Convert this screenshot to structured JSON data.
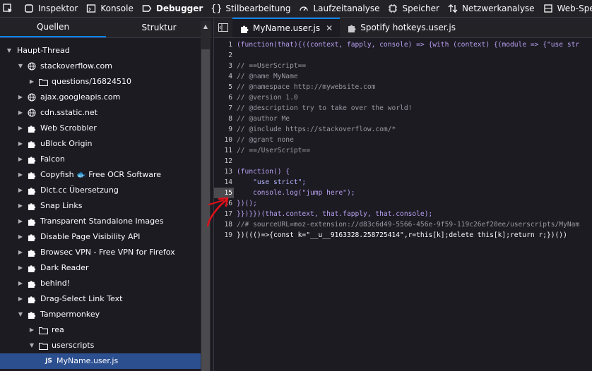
{
  "toolbar": {
    "tabs": [
      {
        "label": "Inspektor",
        "icon": "inspector-icon"
      },
      {
        "label": "Konsole",
        "icon": "console-icon"
      },
      {
        "label": "Debugger",
        "icon": "debugger-icon",
        "active": true
      },
      {
        "label": "Stilbearbeitung",
        "icon": "style-editor-icon"
      },
      {
        "label": "Laufzeitanalyse",
        "icon": "performance-icon"
      },
      {
        "label": "Speicher",
        "icon": "memory-icon"
      },
      {
        "label": "Netzwerkanalyse",
        "icon": "network-icon"
      },
      {
        "label": "Web-Speicher",
        "icon": "storage-icon"
      }
    ]
  },
  "left_panel": {
    "tabs": [
      {
        "label": "Quellen",
        "active": true
      },
      {
        "label": "Struktur"
      }
    ]
  },
  "tree": [
    {
      "label": "Haupt-Thread",
      "indent": 0,
      "expanded": true,
      "icon": "thread"
    },
    {
      "label": "stackoverflow.com",
      "indent": 1,
      "expanded": true,
      "icon": "globe"
    },
    {
      "label": "questions/16824510",
      "indent": 2,
      "expanded": false,
      "icon": "folder"
    },
    {
      "label": "ajax.googleapis.com",
      "indent": 1,
      "expanded": false,
      "icon": "globe"
    },
    {
      "label": "cdn.sstatic.net",
      "indent": 1,
      "expanded": false,
      "icon": "globe"
    },
    {
      "label": "Web Scrobbler",
      "indent": 1,
      "expanded": false,
      "icon": "extension"
    },
    {
      "label": "uBlock Origin",
      "indent": 1,
      "expanded": false,
      "icon": "extension"
    },
    {
      "label": "Falcon",
      "indent": 1,
      "expanded": false,
      "icon": "extension"
    },
    {
      "label": "Copyfish 🐟 Free OCR Software",
      "indent": 1,
      "expanded": false,
      "icon": "extension"
    },
    {
      "label": "Dict.cc Übersetzung",
      "indent": 1,
      "expanded": false,
      "icon": "extension"
    },
    {
      "label": "Snap Links",
      "indent": 1,
      "expanded": false,
      "icon": "extension"
    },
    {
      "label": "Transparent Standalone Images",
      "indent": 1,
      "expanded": false,
      "icon": "extension"
    },
    {
      "label": "Disable Page Visibility API",
      "indent": 1,
      "expanded": false,
      "icon": "extension"
    },
    {
      "label": "Browsec VPN - Free VPN for Firefox",
      "indent": 1,
      "expanded": false,
      "icon": "extension"
    },
    {
      "label": "Dark Reader",
      "indent": 1,
      "expanded": false,
      "icon": "extension"
    },
    {
      "label": "behind!",
      "indent": 1,
      "expanded": false,
      "icon": "extension"
    },
    {
      "label": "Drag-Select Link Text",
      "indent": 1,
      "expanded": false,
      "icon": "extension"
    },
    {
      "label": "Tampermonkey",
      "indent": 1,
      "expanded": true,
      "icon": "extension"
    },
    {
      "label": "rea",
      "indent": 2,
      "expanded": false,
      "icon": "folder"
    },
    {
      "label": "userscripts",
      "indent": 2,
      "expanded": true,
      "icon": "folder"
    },
    {
      "label": "MyName.user.js",
      "indent": 3,
      "icon": "js",
      "selected": true
    }
  ],
  "editor": {
    "tabs": [
      {
        "label": "MyName.user.js",
        "active": true,
        "closable": true
      },
      {
        "label": "Spotify hotkeys.user.js",
        "active": false
      }
    ],
    "lines": [
      {
        "n": "1",
        "text": "(function(that){((context, fapply, console) => {with (context) {(module => {\"use str",
        "kind": "code"
      },
      {
        "n": "2",
        "text": "",
        "kind": "code"
      },
      {
        "n": "3",
        "text": "// ==UserScript==",
        "kind": "comment"
      },
      {
        "n": "4",
        "text": "// @name MyName",
        "kind": "comment"
      },
      {
        "n": "5",
        "text": "// @namespace http://mywebsite.com",
        "kind": "comment"
      },
      {
        "n": "6",
        "text": "// @version 1.0",
        "kind": "comment"
      },
      {
        "n": "7",
        "text": "// @description try to take over the world!",
        "kind": "comment"
      },
      {
        "n": "8",
        "text": "// @author Me",
        "kind": "comment"
      },
      {
        "n": "9",
        "text": "// @include https://stackoverflow.com/*",
        "kind": "comment"
      },
      {
        "n": "10",
        "text": "// @grant none",
        "kind": "comment"
      },
      {
        "n": "11",
        "text": "// ==/UserScript==",
        "kind": "comment"
      },
      {
        "n": "12",
        "text": "",
        "kind": "code"
      },
      {
        "n": "13",
        "text": "(function() {",
        "kind": "code"
      },
      {
        "n": "14",
        "text": "    \"use strict\";",
        "kind": "string"
      },
      {
        "n": "15",
        "text": "    console.log(\"jump here\");",
        "kind": "code",
        "breakpoint": true
      },
      {
        "n": "16",
        "text": "})();",
        "kind": "code"
      },
      {
        "n": "17",
        "text": "}})}})(that.context, that.fapply, that.console);",
        "kind": "code"
      },
      {
        "n": "18",
        "text": "//# sourceURL=moz-extension://d83c6d49-5566-456e-9f59-119c26ef20ee/userscripts/MyNam",
        "kind": "comment"
      },
      {
        "n": "19",
        "text": "})((()=>{const k=\"__u__9163328.258725414\",r=this[k];delete this[k];return r;})())",
        "kind": "mixed"
      }
    ]
  }
}
